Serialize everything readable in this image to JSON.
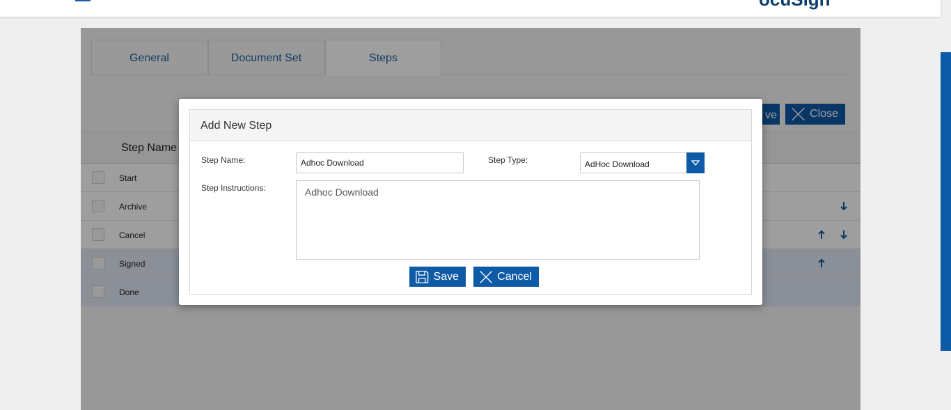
{
  "header": {
    "partial_title": "ocuSign"
  },
  "tabs": [
    {
      "label": "General"
    },
    {
      "label": "Document Set"
    },
    {
      "label": "Steps"
    }
  ],
  "panel_buttons": {
    "save_partial": "ve",
    "close": "Close"
  },
  "grid": {
    "column_header": "Step Name",
    "rows": [
      {
        "name": "Start"
      },
      {
        "name": "Archive"
      },
      {
        "name": "Cancel"
      },
      {
        "name": "Signed"
      },
      {
        "name": "Done"
      }
    ]
  },
  "modal": {
    "title": "Add New Step",
    "step_name_label": "Step Name:",
    "step_name_value": "Adhoc Download",
    "step_type_label": "Step Type:",
    "step_type_value": "AdHoc Download",
    "instructions_label": "Step Instructions:",
    "instructions_value": "Adhoc Download",
    "save_label": "Save",
    "cancel_label": "Cancel"
  },
  "colors": {
    "accent": "#0d5aa7",
    "selected_row": "#dfe7f5"
  }
}
